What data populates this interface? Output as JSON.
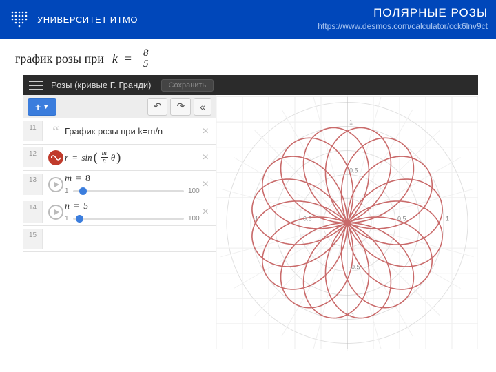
{
  "header": {
    "university": "УНИВЕРСИТЕТ ИТМО",
    "title": "ПОЛЯРНЫЕ РОЗЫ",
    "link": "https://www.desmos.com/calculator/cck6lnv9ct"
  },
  "caption": {
    "text": "график розы при",
    "k_label": "k",
    "k_num": "8",
    "k_den": "5"
  },
  "app": {
    "title": "Розы (кривые Г. Гранди)",
    "save": "Сохранить",
    "add": "+",
    "rows": {
      "r11": {
        "num": "11",
        "text": "График розы при k=m/n"
      },
      "r12": {
        "num": "12",
        "formula_lhs": "r",
        "formula_func": "sin",
        "frac_num": "m",
        "frac_den": "n",
        "theta": "θ"
      },
      "r13": {
        "num": "13",
        "var": "m",
        "val": "8",
        "min": "1",
        "max": "100"
      },
      "r14": {
        "num": "14",
        "var": "n",
        "val": "5",
        "min": "1",
        "max": "100"
      },
      "r15": {
        "num": "15"
      }
    }
  },
  "chart_data": {
    "type": "polar",
    "equation": "r = sin((m/n)*theta)",
    "m": 8,
    "n": 5,
    "theta_range_deg": [
      0,
      1800
    ],
    "axis_ticks": [
      -1,
      -0.5,
      0.5,
      1
    ],
    "grid": true,
    "color": "#c96a6a"
  }
}
